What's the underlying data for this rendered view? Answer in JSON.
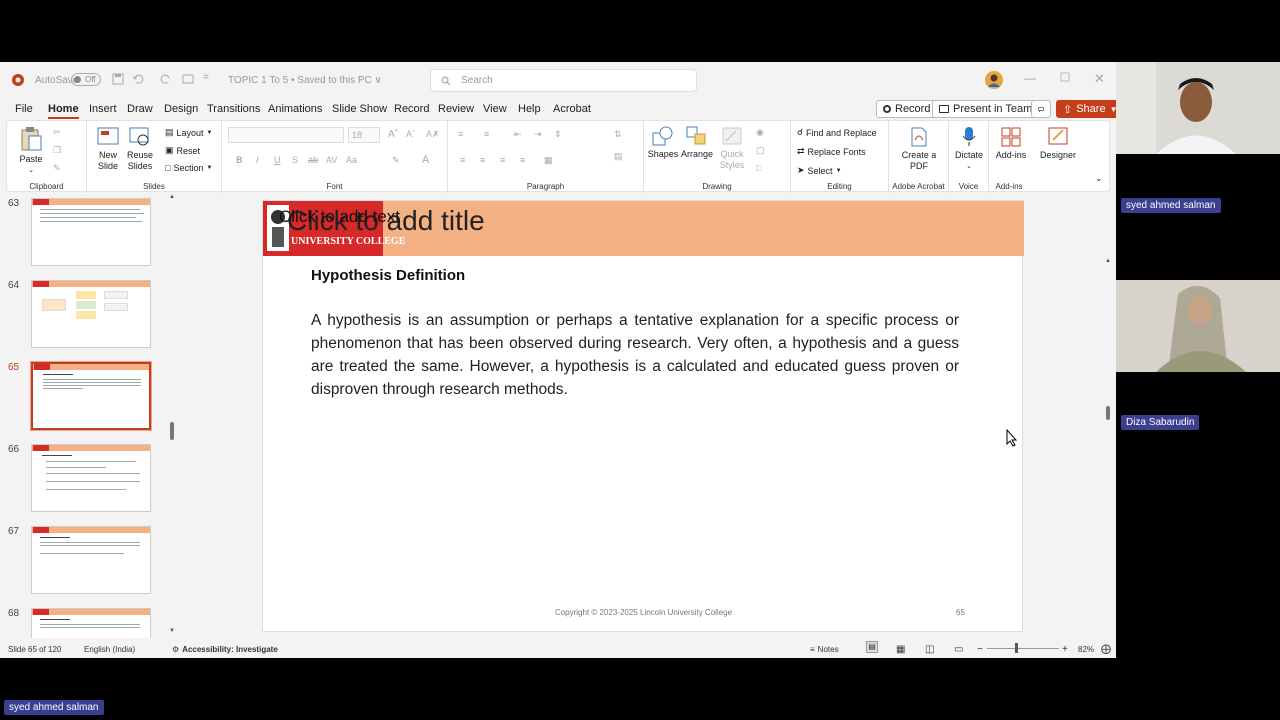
{
  "titlebar": {
    "autosave_label": "AutoSave",
    "autosave_state": "Off",
    "doc_title": "TOPIC 1 To 5 • Saved to this PC ∨",
    "search_placeholder": "Search"
  },
  "menu": {
    "tabs": [
      "File",
      "Home",
      "Insert",
      "Draw",
      "Design",
      "Transitions",
      "Animations",
      "Slide Show",
      "Record",
      "Review",
      "View",
      "Help",
      "Acrobat"
    ],
    "active": "Home",
    "record_btn": "Record",
    "present_btn": "Present in Teams",
    "share_btn": "Share"
  },
  "ribbon": {
    "clipboard": {
      "label": "Clipboard",
      "paste": "Paste"
    },
    "slides": {
      "label": "Slides",
      "new_slide": "New Slide",
      "reuse": "Reuse Slides",
      "layout": "Layout",
      "reset": "Reset",
      "section": "Section"
    },
    "font": {
      "label": "Font",
      "size": "18"
    },
    "paragraph": {
      "label": "Paragraph"
    },
    "drawing": {
      "label": "Drawing",
      "shapes": "Shapes",
      "arrange": "Arrange",
      "quick": "Quick Styles"
    },
    "editing": {
      "label": "Editing",
      "find": "Find and Replace",
      "replace": "Replace Fonts",
      "select": "Select"
    },
    "acrobat": {
      "label": "Adobe Acrobat",
      "create": "Create a PDF"
    },
    "voice": {
      "label": "Voice",
      "dictate": "Dictate"
    },
    "addins": {
      "label": "Add-ins",
      "addins": "Add-ins",
      "designer": "Designer"
    }
  },
  "thumbnails": [
    {
      "num": "63",
      "selected": false
    },
    {
      "num": "64",
      "selected": false
    },
    {
      "num": "65",
      "selected": true
    },
    {
      "num": "66",
      "selected": false
    },
    {
      "num": "67",
      "selected": false
    },
    {
      "num": "68",
      "selected": false
    }
  ],
  "slide": {
    "placeholder_text": "Click to add text",
    "placeholder_title": "Click to add title",
    "logo_text": "UNIVERSITY COLLEGE",
    "heading": "Hypothesis Definition",
    "body": "A hypothesis is an assumption or perhaps a tentative explanation for a specific process or phenomenon that has been observed during research. Very often, a hypothesis and a guess are treated the same. However, a hypothesis is a calculated and educated guess proven or disproven through research methods.",
    "footer": "Copyright © 2023-2025 Lincoln University College",
    "page_number": "65"
  },
  "status": {
    "slide_info": "Slide 65 of 120",
    "language": "English (India)",
    "accessibility": "Accessibility: Investigate",
    "notes": "Notes",
    "zoom": "82%"
  },
  "participants": [
    {
      "name": "syed ahmed salman"
    },
    {
      "name": "Diza Sabarudin"
    }
  ],
  "presenter_name": "syed ahmed salman",
  "colors": {
    "accent": "#c43e1c",
    "band": "#f4b183",
    "logo": "#d62929",
    "badge": "#3a3f8f"
  }
}
